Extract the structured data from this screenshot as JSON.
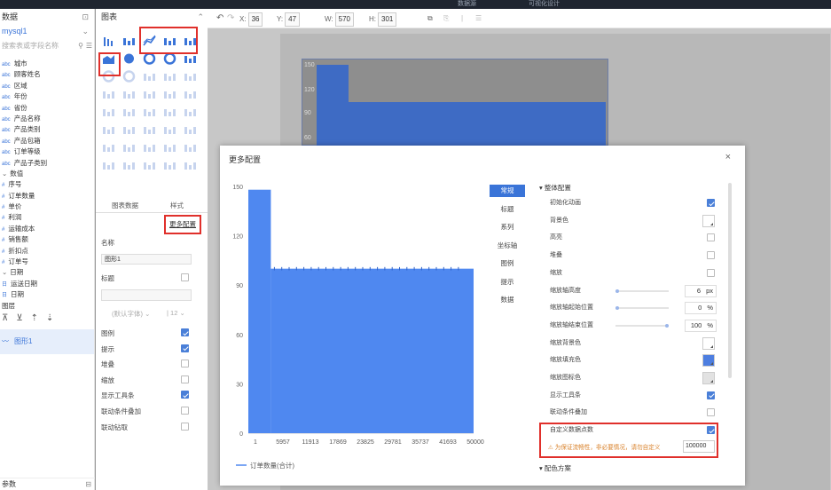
{
  "topbar": {
    "tab1": "数据源",
    "tab2": "可视化设计"
  },
  "left_panel": {
    "title": "数据",
    "datasource": "mysql1",
    "search_placeholder": "搜索表或字段名称",
    "dimensions": [
      {
        "type": "abc",
        "name": "城市"
      },
      {
        "type": "abc",
        "name": "顾客姓名"
      },
      {
        "type": "abc",
        "name": "区域"
      },
      {
        "type": "abc",
        "name": "年份"
      },
      {
        "type": "abc",
        "name": "省份"
      },
      {
        "type": "abc",
        "name": "产品名称"
      },
      {
        "type": "abc",
        "name": "产品类别"
      },
      {
        "type": "abc",
        "name": "产品包箱"
      },
      {
        "type": "abc",
        "name": "订单等级"
      },
      {
        "type": "abc",
        "name": "产品子类别"
      }
    ],
    "measures_group": "数值",
    "measures": [
      {
        "type": "#",
        "name": "序号"
      },
      {
        "type": "#",
        "name": "订单数量"
      },
      {
        "type": "#",
        "name": "单价"
      },
      {
        "type": "#",
        "name": "利润"
      },
      {
        "type": "#",
        "name": "运输成本"
      },
      {
        "type": "#",
        "name": "销售额"
      },
      {
        "type": "#",
        "name": "折扣点"
      },
      {
        "type": "#",
        "name": "订单号"
      }
    ],
    "date_group": "日期",
    "dates": [
      {
        "type": "日",
        "name": "运送日期"
      },
      {
        "type": "日",
        "name": "日期"
      }
    ],
    "layers_title": "图层",
    "selected_item": "图形1",
    "bottom_label": "参数"
  },
  "chart_panel": {
    "title": "图表",
    "tabs": [
      "图表数据",
      "样式"
    ],
    "more_config": "更多配置",
    "name_label": "名称",
    "name_value": "图形1",
    "title_label": "标题",
    "font_placeholder": "(默认字体)",
    "font_size": "12",
    "options": [
      {
        "label": "图例",
        "checked": true
      },
      {
        "label": "提示",
        "checked": true
      },
      {
        "label": "堆叠",
        "checked": false
      },
      {
        "label": "缩放",
        "checked": false
      },
      {
        "label": "显示工具条",
        "checked": true
      },
      {
        "label": "联动条件叠加",
        "checked": false
      },
      {
        "label": "联动钻取",
        "checked": false
      }
    ]
  },
  "toolbar": {
    "x_label": "X:",
    "x": "36",
    "y_label": "Y:",
    "y": "47",
    "w_label": "W:",
    "w": "570",
    "h_label": "H:",
    "h": "301"
  },
  "canvas_chart": {
    "ticks": [
      "150",
      "120",
      "90",
      "60"
    ]
  },
  "modal": {
    "title": "更多配置",
    "close": "×",
    "tabs": [
      {
        "label": "常规",
        "active": true
      },
      {
        "label": "标题",
        "active": false
      },
      {
        "label": "系列",
        "active": false
      },
      {
        "label": "坐标轴",
        "active": false
      },
      {
        "label": "图例",
        "active": false
      },
      {
        "label": "提示",
        "active": false
      },
      {
        "label": "数据",
        "active": false
      }
    ],
    "section_overall": "整体配置",
    "rows": [
      {
        "label": "初始化动画",
        "kind": "checkbox",
        "checked": true
      },
      {
        "label": "背景色",
        "kind": "color",
        "color": "#ffffff"
      },
      {
        "label": "高亮",
        "kind": "checkbox",
        "checked": false
      },
      {
        "label": "堆叠",
        "kind": "checkbox",
        "checked": false
      },
      {
        "label": "缩放",
        "kind": "checkbox",
        "checked": false
      },
      {
        "label": "缩放轴高度",
        "kind": "slider",
        "value": "6",
        "unit": "px",
        "level": 0.0
      },
      {
        "label": "缩放轴起始位置",
        "kind": "slider",
        "value": "0",
        "unit": "%",
        "level": 0.0
      },
      {
        "label": "缩放轴结束位置",
        "kind": "slider",
        "value": "100",
        "unit": "%",
        "level": 1.0
      },
      {
        "label": "缩放背景色",
        "kind": "color",
        "color": "#ffffff"
      },
      {
        "label": "缩放填充色",
        "kind": "color",
        "color": "#4d7ee0"
      },
      {
        "label": "缩放图标色",
        "kind": "color",
        "color": "#e2e2e2"
      },
      {
        "label": "显示工具条",
        "kind": "checkbox",
        "checked": true
      },
      {
        "label": "联动条件叠加",
        "kind": "checkbox",
        "checked": false
      },
      {
        "label": "自定义数据点数",
        "kind": "checkbox",
        "checked": true
      }
    ],
    "warning": "为保证流畅性，非必要情况，请勿自定义",
    "custom_points_value": "100000",
    "section_scheme": "配色方案"
  },
  "chart_data": {
    "type": "bar",
    "title": "",
    "xlabel": "",
    "ylabel": "",
    "x_ticks": [
      "1",
      "5957",
      "11913",
      "17869",
      "23825",
      "29781",
      "35737",
      "41693",
      "50000"
    ],
    "y_ticks": [
      0,
      30,
      60,
      90,
      120,
      150
    ],
    "ylim": [
      0,
      150
    ],
    "series": [
      {
        "name": "订单数量(合计)",
        "color": "#4f88f0",
        "segments": [
          {
            "from": "1",
            "to": "5000",
            "value": 148
          },
          {
            "from": "5000",
            "to": "50000",
            "value": 100
          }
        ]
      }
    ],
    "legend": "bottom-left",
    "grid": false
  }
}
